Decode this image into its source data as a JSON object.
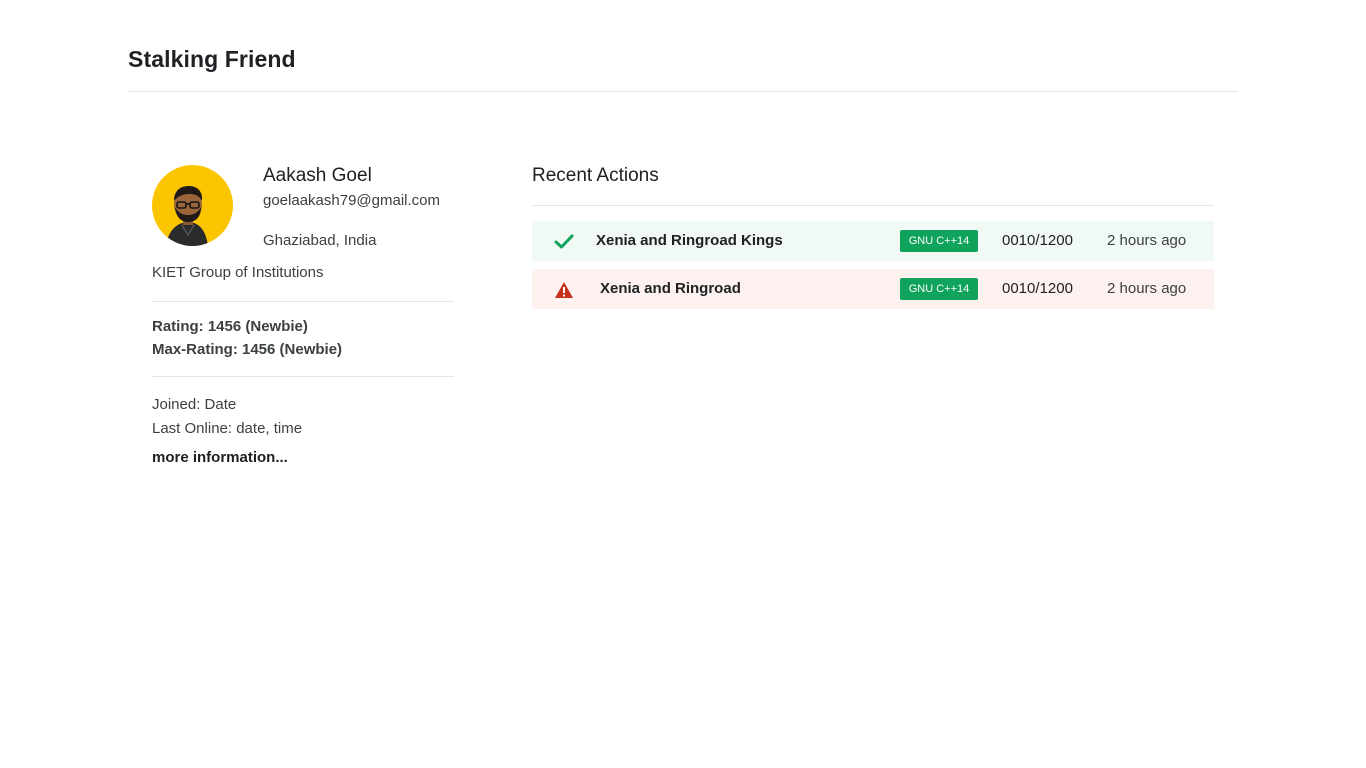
{
  "header": {
    "title": "Stalking Friend"
  },
  "profile": {
    "avatar_icon": "user-avatar",
    "avatar_bg": "#fbc500",
    "name": "Aakash Goel",
    "email": "goelaakash79@gmail.com",
    "location": "Ghaziabad, India",
    "organization": "KIET Group of Institutions",
    "rating": "Rating: 1456 (Newbie)",
    "max_rating": "Max-Rating: 1456 (Newbie)",
    "joined": "Joined: Date",
    "last_online": "Last Online: date, time",
    "more_info_label": "more information..."
  },
  "recent_actions": {
    "title": "Recent Actions",
    "items": [
      {
        "status": "accepted",
        "status_icon": "check-icon",
        "status_color": "#10a35b",
        "problem": "Xenia and Ringroad Kings",
        "language": "GNU C++14",
        "score": "0010/1200",
        "time": "2 hours ago",
        "row_bg": "#f1f9f5"
      },
      {
        "status": "warning",
        "status_icon": "warning-icon",
        "status_color": "#c5321b",
        "problem": "Xenia and Ringroad",
        "language": "GNU C++14",
        "score": "0010/1200",
        "time": "2 hours ago",
        "row_bg": "#fdf2ef"
      }
    ]
  },
  "colors": {
    "badge_green": "#10a35b",
    "divider": "#e4e6e8"
  }
}
